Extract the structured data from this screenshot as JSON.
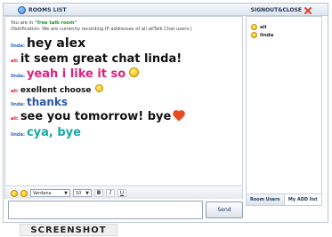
{
  "header": {
    "rooms_list": "ROOMS LIST",
    "signout_close": "SIGNOUT&CLOSE"
  },
  "chat": {
    "room_prefix": "You are in ",
    "room_name": "\"free talk room\"",
    "notification": "(Notification: We are currently recording IP addresses of all allTalk Chat users.)",
    "messages": [
      {
        "nick": "linda:",
        "text": "hey alex"
      },
      {
        "nick": "ali:",
        "text": "it seem great chat linda!"
      },
      {
        "nick": "linda:",
        "text": "yeah i like it so"
      },
      {
        "nick": "ali:",
        "text": "exellent choose"
      },
      {
        "nick": "linda:",
        "text": "thanks"
      },
      {
        "nick": "ali:",
        "text": "see you tomorrow! bye"
      },
      {
        "nick": "linda:",
        "text": "cya, bye"
      }
    ]
  },
  "users": {
    "list": [
      "ali",
      "linda"
    ],
    "tabs": [
      "Room Users",
      "My ADD list"
    ]
  },
  "toolbar": {
    "font": "Verdana",
    "size": "10",
    "bold": "B",
    "italic": "I",
    "underline": "U"
  },
  "input": {
    "value": "",
    "send_label": "Send"
  },
  "caption": "SCREENSHOT",
  "colors": {
    "linda_nick": "#2a63c8",
    "ali_nick": "#d02020",
    "pink_text": "#e0207e",
    "blue_text": "#2d56a8",
    "teal_text": "#19a6a6",
    "room_name": "#1a9a1a"
  }
}
